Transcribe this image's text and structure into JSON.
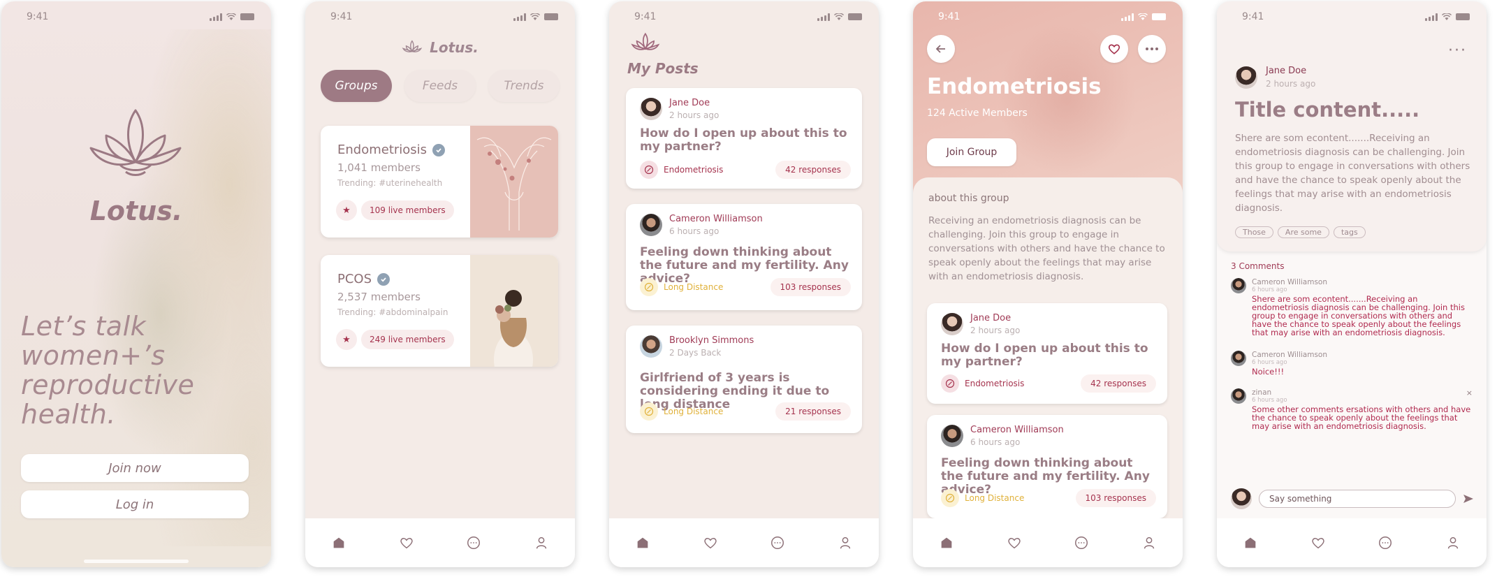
{
  "status_time": "9:41",
  "screen1": {
    "brand": "Lotus.",
    "tagline": "Let’s talk women+’s reproductive health.",
    "join_label": "Join now",
    "login_label": "Log in"
  },
  "screen2": {
    "brand": "Lotus.",
    "tabs": [
      "Groups",
      "Feeds",
      "Trends"
    ],
    "groups": [
      {
        "name": "Endometriosis",
        "members": "1,041 members",
        "trending": "Trending: #uterinehealth",
        "live": "109 live members"
      },
      {
        "name": "PCOS",
        "members": "2,537 members",
        "trending": "Trending: #abdominalpain",
        "live": "249 live members"
      }
    ]
  },
  "screen3": {
    "title": "My Posts",
    "posts": [
      {
        "author": "Jane Doe",
        "time": "2 hours ago",
        "title": "How do I open up about this to my partner?",
        "tag": "Endometriosis",
        "responses": "42 responses"
      },
      {
        "author": "Cameron Williamson",
        "time": "6 hours ago",
        "title": "Feeling down thinking about the future and my fertility. Any advice?",
        "tag": "Long Distance",
        "responses": "103 responses"
      },
      {
        "author": "Brooklyn Simmons",
        "time": "2 Days Back",
        "title": "Girlfriend of 3 years is considering ending it due to long distance",
        "tag": "Long Distance",
        "responses": "21 responses"
      }
    ]
  },
  "screen4": {
    "title": "Endometriosis",
    "members": "124 Active Members",
    "join_label": "Join Group",
    "about_title": "about this group",
    "about_text": "Receiving an endometriosis diagnosis can be challenging. Join this group to engage in conversations with others and have the chance to speak openly about the feelings that may arise with an endometriosis diagnosis.",
    "posts": [
      {
        "author": "Jane Doe",
        "time": "2 hours ago",
        "title": "How do I open up about this to my partner?",
        "tag": "Endometriosis",
        "responses": "42 responses"
      },
      {
        "author": "Cameron Williamson",
        "time": "6 hours ago",
        "title": "Feeling down thinking about the future and my fertility. Any advice?",
        "tag": "Long Distance",
        "responses": "103 responses"
      }
    ]
  },
  "screen5": {
    "more": "···",
    "author": "Jane Doe",
    "time": "2 hours ago",
    "title": "Title content.....",
    "body": " Shere are som econtent.......Receiving an endometriosis diagnosis can be challenging. Join this group to engage in conversations with others and have the chance to speak openly about the feelings that may arise with an endometriosis diagnosis.",
    "tags": [
      "Those",
      "Are some",
      "tags"
    ],
    "comments_title": "3 Comments",
    "comments": [
      {
        "name": "Cameron Williamson",
        "time": "6 hours ago",
        "text": " Shere are som econtent.......Receiving an endometriosis diagnosis can be challenging. Join this group to engage in conversations with others and have the chance to speak openly about the feelings that may arise with an endometriosis diagnosis."
      },
      {
        "name": "Cameron Williamson",
        "time": "6 hours ago",
        "text": "Noice!!!"
      },
      {
        "name": "zinan",
        "time": "6 hours ago",
        "text": "Some other comments ersations with others and have the chance to speak openly about the feelings that may arise with an endometriosis diagnosis."
      }
    ],
    "close_glyph": "×",
    "input_placeholder": "Say something"
  },
  "colors": {
    "accent": "#9e7a84",
    "live_red": "#a5334e",
    "gold": "#e0b13a",
    "blue_check": "#8fa1b3"
  },
  "icons": [
    "home-icon",
    "heart-icon",
    "chat-icon",
    "profile-icon",
    "lotus-icon",
    "back-arrow-icon",
    "more-icon",
    "send-icon",
    "star-icon",
    "verified-check-icon"
  ]
}
